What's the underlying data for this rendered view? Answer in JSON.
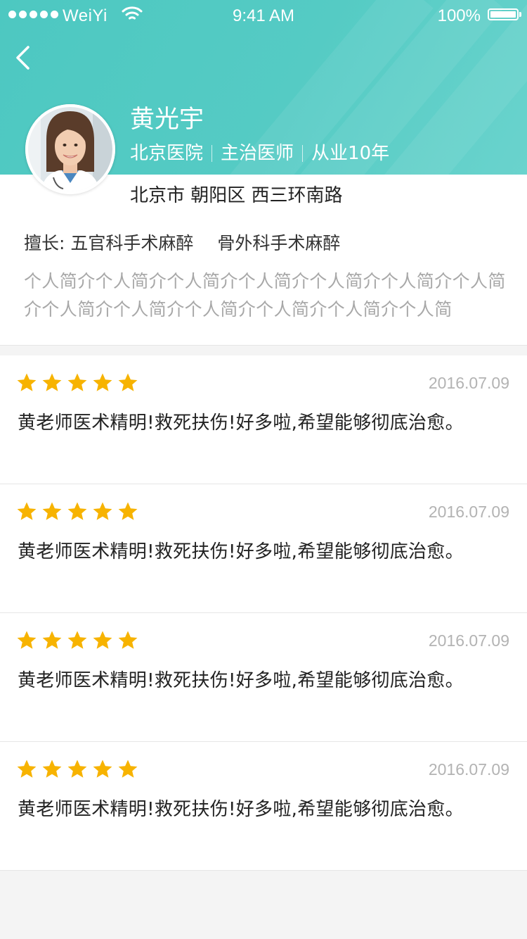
{
  "status_bar": {
    "carrier": "WeiYi",
    "time": "9:41 AM",
    "battery": "100%"
  },
  "colors": {
    "header_teal": "#55cbc4",
    "star_gold": "#f7b300",
    "muted_text": "#a8a8a8"
  },
  "icons": {
    "back": "chevron-left-icon",
    "star": "star-icon",
    "wifi": "wifi-icon",
    "battery": "battery-icon"
  },
  "doctor": {
    "name": "黄光宇",
    "hospital": "北京医院",
    "title": "主治医师",
    "experience": "从业10年",
    "address": "北京市 朝阳区 西三环南路",
    "specialty_label": "擅长:",
    "specialties": [
      "五官科手术麻醉",
      "骨外科手术麻醉"
    ],
    "bio": "个人简介个人简介个人简介个人简介个人简介个人简介个人简介个人简介个人简介个人简介个人简介个人简介个人简"
  },
  "reviews": [
    {
      "rating": 5,
      "date": "2016.07.09",
      "text": "黄老师医术精明!救死扶伤!好多啦,希望能够彻底治愈。"
    },
    {
      "rating": 5,
      "date": "2016.07.09",
      "text": "黄老师医术精明!救死扶伤!好多啦,希望能够彻底治愈。"
    },
    {
      "rating": 5,
      "date": "2016.07.09",
      "text": "黄老师医术精明!救死扶伤!好多啦,希望能够彻底治愈。"
    },
    {
      "rating": 5,
      "date": "2016.07.09",
      "text": "黄老师医术精明!救死扶伤!好多啦,希望能够彻底治愈。"
    }
  ]
}
